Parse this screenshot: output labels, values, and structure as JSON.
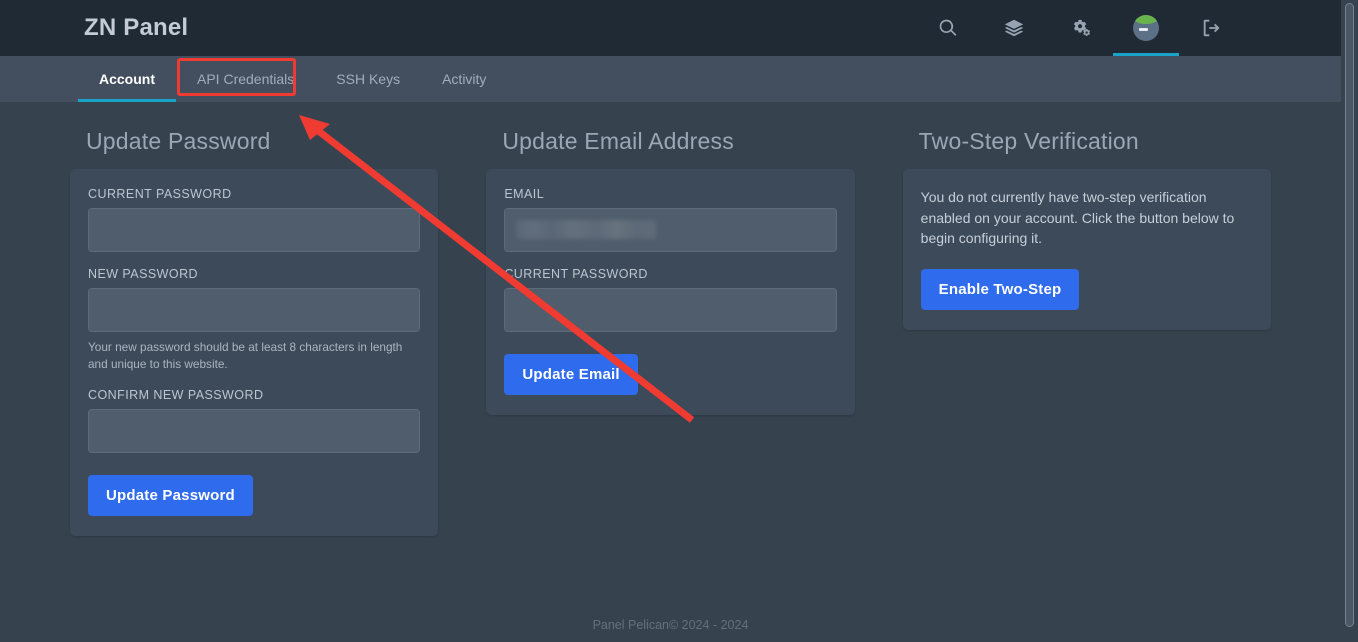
{
  "header": {
    "brand": "ZN Panel",
    "nav": [
      {
        "name": "search-icon",
        "label": "Search",
        "active": false
      },
      {
        "name": "servers-icon",
        "label": "Servers",
        "active": false
      },
      {
        "name": "admin-cogs-icon",
        "label": "Admin",
        "active": false
      },
      {
        "name": "account-avatar",
        "label": "Account",
        "active": true
      },
      {
        "name": "logout-icon",
        "label": "Logout",
        "active": false
      }
    ]
  },
  "tabs": [
    {
      "label": "Account",
      "active": true
    },
    {
      "label": "API Credentials",
      "active": false,
      "highlighted": true
    },
    {
      "label": "SSH Keys",
      "active": false
    },
    {
      "label": "Activity",
      "active": false
    }
  ],
  "password_card": {
    "title": "Update Password",
    "current_password_label": "CURRENT PASSWORD",
    "current_password_value": "",
    "new_password_label": "NEW PASSWORD",
    "new_password_value": "",
    "help_text": "Your new password should be at least 8 characters in length and unique to this website.",
    "confirm_password_label": "CONFIRM NEW PASSWORD",
    "confirm_password_value": "",
    "submit_label": "Update Password"
  },
  "email_card": {
    "title": "Update Email Address",
    "email_label": "EMAIL",
    "email_value": "",
    "email_redacted": true,
    "current_password_label": "CURRENT PASSWORD",
    "current_password_value": "",
    "submit_label": "Update Email"
  },
  "twostep_card": {
    "title": "Two-Step Verification",
    "body": "You do not currently have two-step verification enabled on your account. Click the button below to begin configuring it.",
    "submit_label": "Enable Two-Step"
  },
  "footer": {
    "text": "Panel Pelican© 2024 - 2024"
  },
  "annotation": {
    "highlight_target": "API Credentials",
    "color": "#f03b33"
  },
  "colors": {
    "header_bg": "#1f2a35",
    "tabbar_bg": "#434f5e",
    "body_bg": "#36434f",
    "card_bg": "#3c4a59",
    "input_bg": "#4f5d6c",
    "accent_blue": "#2f6bed",
    "accent_cyan": "#1aa3c8",
    "annotation_red": "#f03b33"
  }
}
